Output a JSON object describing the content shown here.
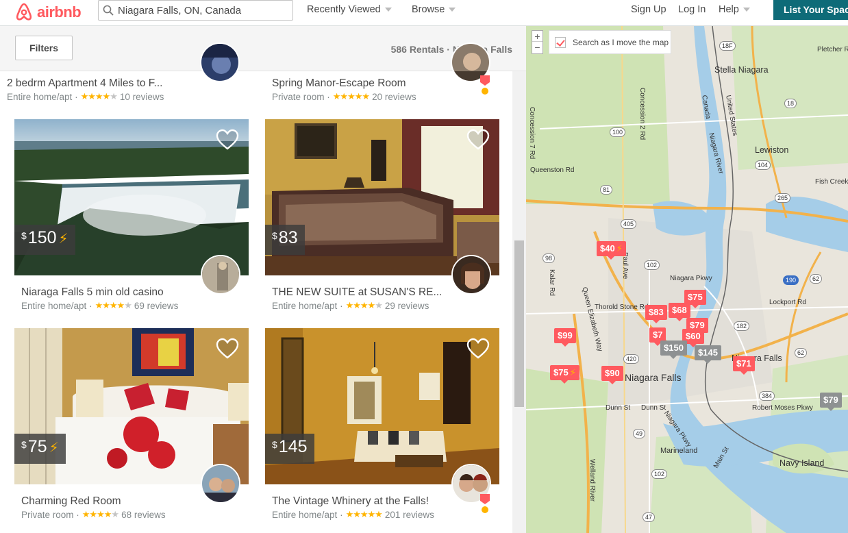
{
  "header": {
    "brand": "airbnb",
    "search_value": "Niagara Falls, ON, Canada",
    "nav": [
      {
        "label": "Recently Viewed"
      },
      {
        "label": "Browse"
      },
      {
        "label": "Sign Up"
      },
      {
        "label": "Log In"
      },
      {
        "label": "Help"
      }
    ],
    "list_space": "List Your Space"
  },
  "results": {
    "filters_label": "Filters",
    "count_label": "586 Rentals · Niagara Falls"
  },
  "listings": [
    {
      "title": "2 bedrm Apartment 4 Miles to F...",
      "type": "Entire home/apt",
      "rating": 4.5,
      "reviews": "10 reviews"
    },
    {
      "title": "Spring Manor-Escape Room",
      "type": "Private room",
      "rating": 5,
      "reviews": "20 reviews",
      "superhost": true
    },
    {
      "title": "Niaraga Falls 5 min old casino",
      "type": "Entire home/apt",
      "rating": 4.5,
      "reviews": "69 reviews",
      "price": "150",
      "instant": true
    },
    {
      "title": "THE NEW SUITE at SUSAN'S RE...",
      "type": "Entire home/apt",
      "rating": 4,
      "reviews": "29 reviews",
      "price": "83",
      "instant": false
    },
    {
      "title": "Charming Red Room",
      "type": "Private room",
      "rating": 4.5,
      "reviews": "68 reviews",
      "price": "75",
      "instant": true
    },
    {
      "title": "The Vintage Whinery at the Falls!",
      "type": "Entire home/apt",
      "rating": 5,
      "reviews": "201 reviews",
      "price": "145",
      "instant": false,
      "superhost": true
    }
  ],
  "currency": "$",
  "map": {
    "search_as_move": "Search as I move the map",
    "zoom_in": "+",
    "zoom_out": "−",
    "pins": [
      {
        "label": "$40",
        "color": "red",
        "instant": true
      },
      {
        "label": "$75",
        "color": "red"
      },
      {
        "label": "$83",
        "color": "red"
      },
      {
        "label": "$68",
        "color": "red"
      },
      {
        "label": "$79",
        "color": "red"
      },
      {
        "label": "$99",
        "color": "red"
      },
      {
        "label": "$7",
        "color": "red"
      },
      {
        "label": "$60",
        "color": "red"
      },
      {
        "label": "$150",
        "color": "grey"
      },
      {
        "label": "$145",
        "color": "grey"
      },
      {
        "label": "$71",
        "color": "red"
      },
      {
        "label": "$75",
        "color": "red",
        "instant": true
      },
      {
        "label": "$90",
        "color": "red"
      },
      {
        "label": "$79",
        "color": "grey"
      }
    ],
    "places": [
      "Stella Niagara",
      "Lewiston",
      "Niagara Falls",
      "Niagara Falls",
      "Marineland",
      "Navy Island",
      "Pletcher Rd",
      "Concession 2 Rd",
      "Concession 7 Rd",
      "Queenston Rd",
      "Fish Creek",
      "Thorold Stone Rd",
      "Lockport Rd",
      "Niagara Pkwy",
      "Kalar Rd",
      "Paul Ave",
      "Queen Elizabeth Way",
      "Dunn St",
      "Robert Moses Pkwy",
      "Main St",
      "Welland River",
      "Niagara River",
      "Canada",
      "United States",
      "Niagara Pkwy",
      "Dunn St"
    ],
    "route_shields": [
      "18F",
      "18",
      "100",
      "104",
      "265",
      "81",
      "405",
      "102",
      "190",
      "182",
      "420",
      "384",
      "49",
      "102",
      "47",
      "98",
      "62",
      "62"
    ]
  },
  "colors": {
    "brand": "#ff5a5f",
    "list_space_bg": "#0e6b78",
    "star": "#ffb400"
  }
}
